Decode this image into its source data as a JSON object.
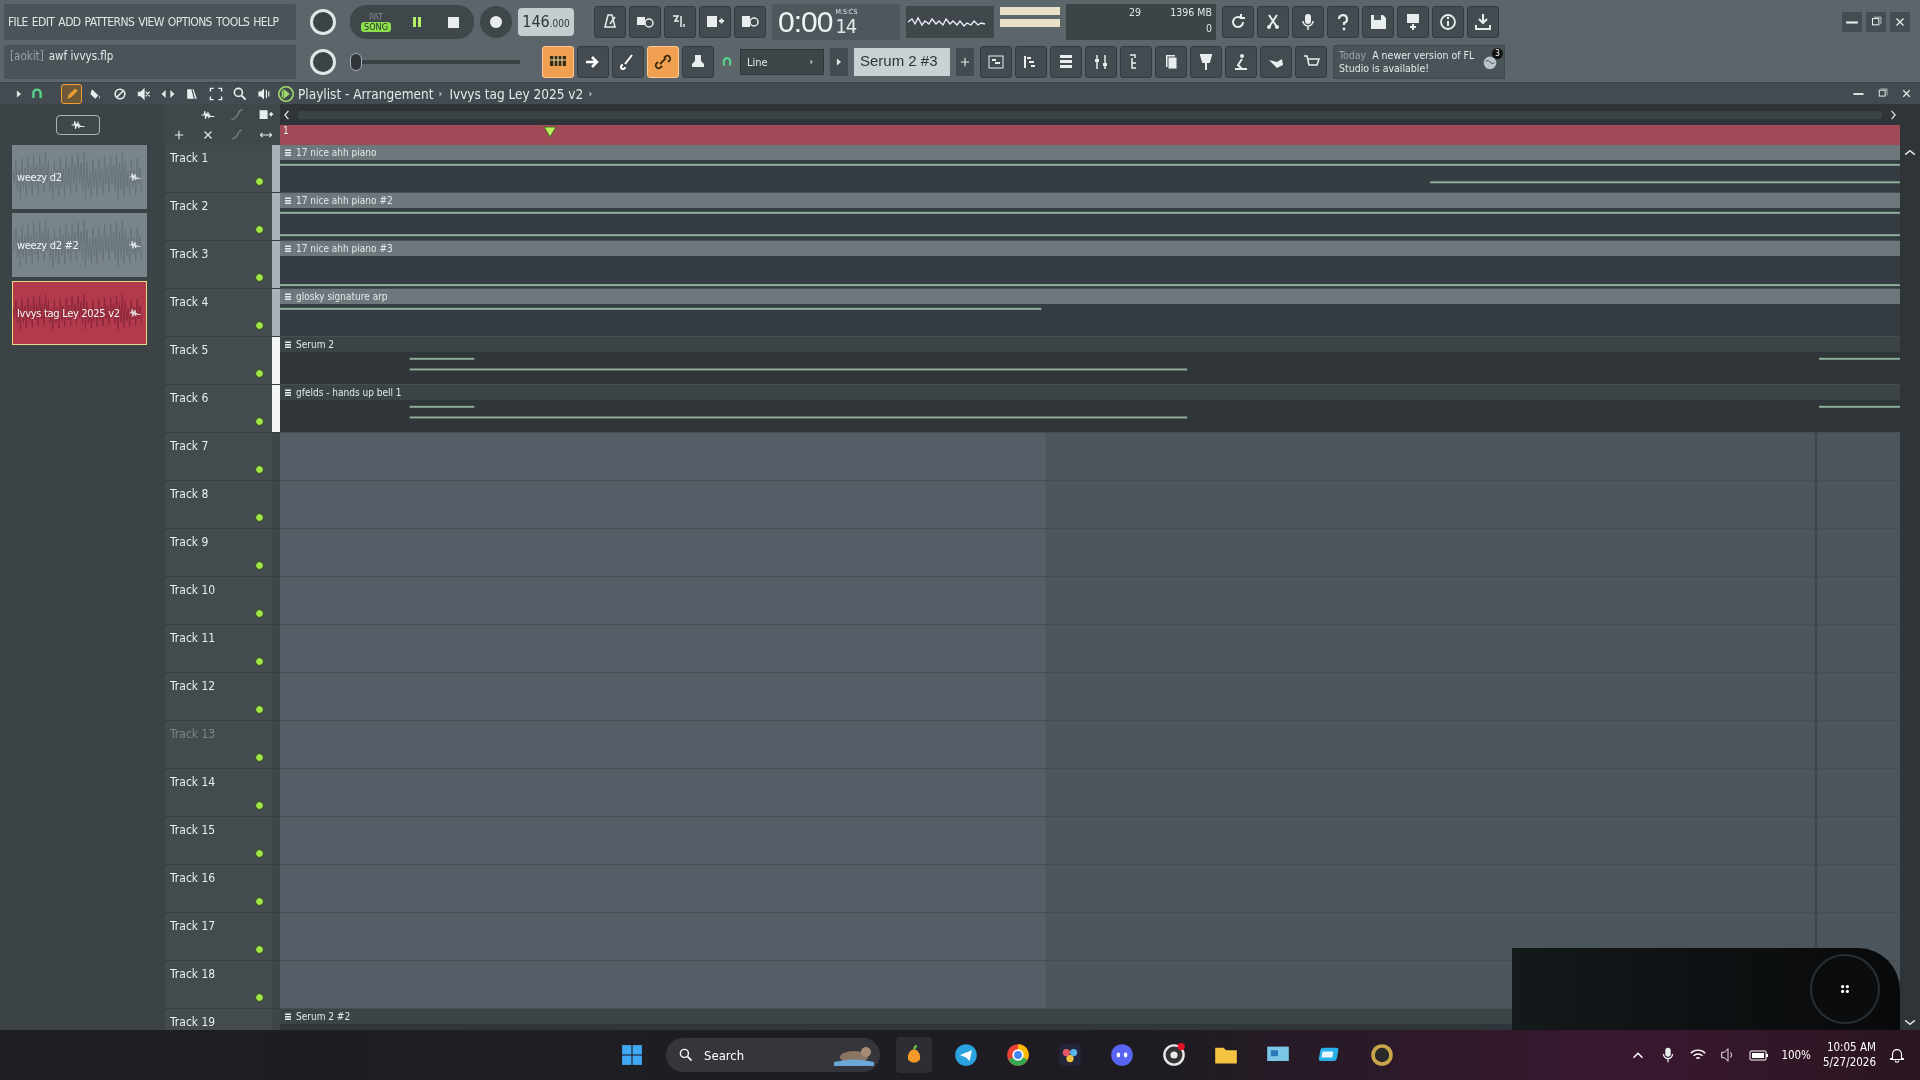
{
  "menu": [
    "FILE",
    "EDIT",
    "ADD",
    "PATTERNS",
    "VIEW",
    "OPTIONS",
    "TOOLS",
    "HELP"
  ],
  "hint": {
    "prefix": "[aokit]",
    "text": "awf ivvys.flp"
  },
  "transport": {
    "modes": [
      {
        "label": "PAT",
        "selected": false
      },
      {
        "label": "SONG",
        "selected": true
      }
    ],
    "playing": true,
    "tempo": "146",
    "tempo_decimals": ".000"
  },
  "time": {
    "value": "0:00",
    "centis": "14",
    "format": "M:S:CS"
  },
  "monitor": {
    "cpu": "29",
    "memory": "1396 MB",
    "polyphony": "0"
  },
  "tool_buttons": [
    {
      "on": true
    },
    {
      "on": false
    },
    {
      "on": false
    },
    {
      "on": true
    },
    {
      "on": false
    }
  ],
  "pitch": {
    "level": 0
  },
  "snap": "Line",
  "channel": "Serum 2 #3",
  "news": {
    "when": "Today",
    "message": "A newer version of FL Studio is available!",
    "badge": "3"
  },
  "playlist": {
    "title": "Playlist - Arrangement",
    "pattern": "Ivvys tag Ley 2025 v2",
    "tools": [
      {
        "selected": true
      },
      {
        "selected": false
      },
      {
        "selected": false
      },
      {
        "selected": false
      },
      {
        "selected": false
      },
      {
        "selected": false
      },
      {
        "selected": false
      },
      {
        "selected": false
      },
      {
        "selected": false
      }
    ],
    "ruler_start": "1"
  },
  "picker": [
    {
      "name": "weezy d2",
      "selected": false
    },
    {
      "name": "weezy d2 #2",
      "selected": false
    },
    {
      "name": "Ivvys tag Ley 2025 v2",
      "selected": true
    }
  ],
  "tracks": [
    {
      "name": "Track 1",
      "disabled": false,
      "color": "#aab2b8",
      "clips": [
        {
          "name": "17 nice ahh piano",
          "kind": "light"
        }
      ]
    },
    {
      "name": "Track 2",
      "disabled": false,
      "color": "#aab2b8",
      "clips": [
        {
          "name": "17 nice ahh piano #2",
          "kind": "light"
        }
      ]
    },
    {
      "name": "Track 3",
      "disabled": false,
      "color": "#aab2b8",
      "clips": [
        {
          "name": "17 nice ahh piano #3",
          "kind": "light"
        }
      ]
    },
    {
      "name": "Track 4",
      "disabled": false,
      "color": "#aab2b8",
      "clips": [
        {
          "name": "glosky signature arp",
          "kind": "light"
        }
      ]
    },
    {
      "name": "Track 5",
      "disabled": false,
      "color": "#f4f6f6",
      "clips": [
        {
          "name": "Serum 2",
          "kind": "dark"
        }
      ]
    },
    {
      "name": "Track 6",
      "disabled": false,
      "color": "#f4f6f6",
      "clips": [
        {
          "name": "gfelds - hands up bell 1",
          "kind": "dark"
        }
      ]
    },
    {
      "name": "Track 7",
      "disabled": false
    },
    {
      "name": "Track 8",
      "disabled": false
    },
    {
      "name": "Track 9",
      "disabled": false
    },
    {
      "name": "Track 10",
      "disabled": false
    },
    {
      "name": "Track 11",
      "disabled": false
    },
    {
      "name": "Track 12",
      "disabled": false
    },
    {
      "name": "Track 13",
      "disabled": true
    },
    {
      "name": "Track 14",
      "disabled": false
    },
    {
      "name": "Track 15",
      "disabled": false
    },
    {
      "name": "Track 16",
      "disabled": false
    },
    {
      "name": "Track 17",
      "disabled": false
    },
    {
      "name": "Track 18",
      "disabled": false
    },
    {
      "name": "Track 19",
      "disabled": false,
      "clips": [
        {
          "name": "Serum 2 #2",
          "kind": "dark"
        }
      ]
    }
  ],
  "taskbar": {
    "search": "Search",
    "battery": "100%",
    "time": "10:05 AM",
    "date": "5/27/2026"
  }
}
